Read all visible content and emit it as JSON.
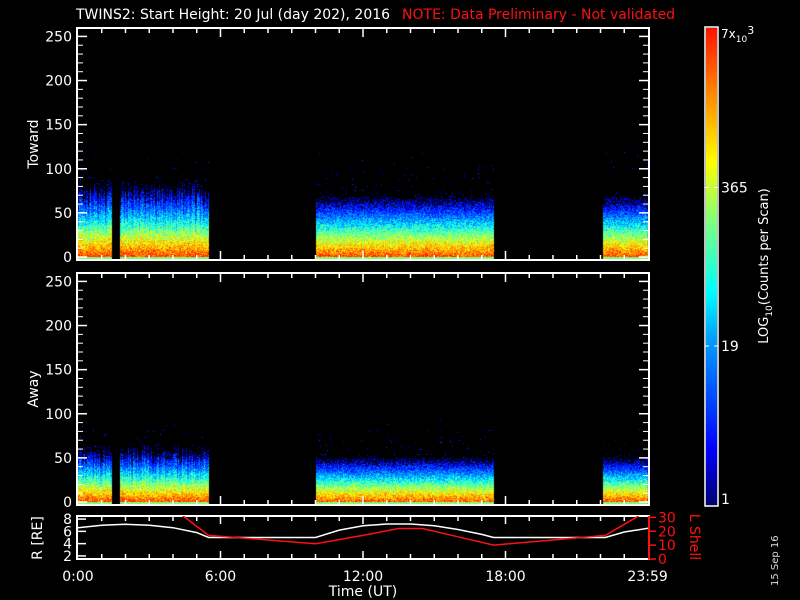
{
  "title": {
    "main": "TWINS2: Start Height: 20 Jul (day 202), 2016",
    "note": "NOTE: Data Preliminary - Not validated"
  },
  "datestamp": "15 Sep 16",
  "colors": {
    "note": "#ff1010",
    "orbit_R": "#ffffff",
    "orbit_L": "#ff1010"
  },
  "chart_data": [
    {
      "type": "heatmap",
      "name": "Toward",
      "ylabel": "Toward",
      "ylim": [
        0,
        255
      ],
      "yticks": [
        "0",
        "50",
        "100",
        "150",
        "200",
        "250"
      ],
      "x_hours": [
        0,
        24
      ],
      "data_intervals_hours": [
        [
          0,
          1.45
        ],
        [
          1.75,
          5.5
        ],
        [
          10.0,
          17.5
        ],
        [
          22.1,
          24
        ]
      ],
      "typical_max_height": 80
    },
    {
      "type": "heatmap",
      "name": "Away",
      "ylabel": "Away",
      "ylim": [
        0,
        255
      ],
      "yticks": [
        "0",
        "50",
        "100",
        "150",
        "200",
        "250"
      ],
      "x_hours": [
        0,
        24
      ],
      "data_intervals_hours": [
        [
          0,
          1.45
        ],
        [
          1.75,
          5.5
        ],
        [
          10.0,
          17.5
        ],
        [
          22.1,
          24
        ]
      ],
      "typical_max_height": 60
    },
    {
      "type": "line",
      "name": "orbit",
      "xlabel": "Time (UT)",
      "xticks": [
        "0:00",
        "6:00",
        "12:00",
        "18:00",
        "23:59"
      ],
      "ylabel_left": "R [RE]",
      "ylim_left": [
        1.5,
        8.5
      ],
      "yticks_left": [
        "2",
        "4",
        "6",
        "8"
      ],
      "ylabel_right": "L Shell",
      "ylim_right": [
        0,
        31
      ],
      "yticks_right": [
        "0",
        "10",
        "20",
        "30"
      ],
      "series": [
        {
          "name": "R",
          "axis": "left",
          "x": [
            0,
            1,
            2,
            3,
            4,
            5,
            5.5,
            10,
            11,
            12,
            13,
            14,
            15,
            16,
            17,
            17.5,
            22.2,
            23,
            24
          ],
          "y": [
            6.6,
            7.0,
            7.15,
            7.0,
            6.6,
            5.8,
            5.0,
            5.0,
            6.2,
            6.9,
            7.2,
            7.2,
            6.9,
            6.3,
            5.5,
            5.0,
            5.0,
            5.9,
            6.5
          ]
        },
        {
          "name": "L Shell",
          "axis": "right",
          "x": [
            4.35,
            5.5,
            10,
            12,
            13.5,
            14.5,
            16,
            17.5,
            22.2,
            23.6
          ],
          "y": [
            32,
            17,
            11,
            17,
            22,
            22,
            16,
            10,
            17,
            31
          ]
        }
      ]
    },
    {
      "type": "colorbar",
      "label": "LOG10(Counts per Scan)",
      "label_main": "LOG",
      "label_sub": "10",
      "label_rest": "(Counts per Scan)",
      "ticks": [
        "1",
        "19",
        "365",
        "7x10^3"
      ],
      "tick_values": [
        1,
        19,
        365,
        7000
      ],
      "top_label_base": "7x",
      "top_label_sub": "10",
      "top_label_sup": "3"
    }
  ]
}
